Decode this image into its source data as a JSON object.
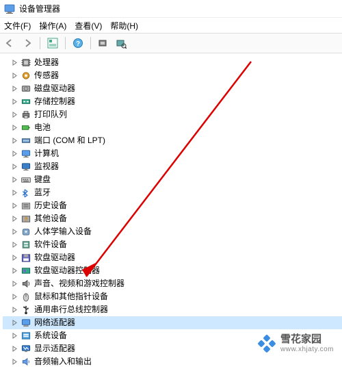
{
  "titlebar": {
    "title": "设备管理器"
  },
  "menubar": {
    "file": "文件(F)",
    "action": "操作(A)",
    "view": "查看(V)",
    "help": "帮助(H)"
  },
  "tree": {
    "items": [
      {
        "label": "处理器",
        "icon": "cpu"
      },
      {
        "label": "传感器",
        "icon": "sensor"
      },
      {
        "label": "磁盘驱动器",
        "icon": "disk"
      },
      {
        "label": "存储控制器",
        "icon": "storage-ctrl"
      },
      {
        "label": "打印队列",
        "icon": "printer"
      },
      {
        "label": "电池",
        "icon": "battery"
      },
      {
        "label": "端口 (COM 和 LPT)",
        "icon": "port"
      },
      {
        "label": "计算机",
        "icon": "computer"
      },
      {
        "label": "监视器",
        "icon": "monitor"
      },
      {
        "label": "键盘",
        "icon": "keyboard"
      },
      {
        "label": "蓝牙",
        "icon": "bluetooth"
      },
      {
        "label": "历史设备",
        "icon": "history"
      },
      {
        "label": "其他设备",
        "icon": "other"
      },
      {
        "label": "人体学输入设备",
        "icon": "hid"
      },
      {
        "label": "软件设备",
        "icon": "software"
      },
      {
        "label": "软盘驱动器",
        "icon": "floppy"
      },
      {
        "label": "软盘驱动器控制器",
        "icon": "floppy-ctrl"
      },
      {
        "label": "声音、视频和游戏控制器",
        "icon": "audio"
      },
      {
        "label": "鼠标和其他指针设备",
        "icon": "mouse"
      },
      {
        "label": "通用串行总线控制器",
        "icon": "usb"
      },
      {
        "label": "网络适配器",
        "icon": "network",
        "hl": true
      },
      {
        "label": "系统设备",
        "icon": "system"
      },
      {
        "label": "显示适配器",
        "icon": "display"
      },
      {
        "label": "音频输入和输出",
        "icon": "audio-io"
      }
    ]
  },
  "watermark": {
    "main": "雪花家园",
    "sub": "www.xhjaty.com"
  }
}
